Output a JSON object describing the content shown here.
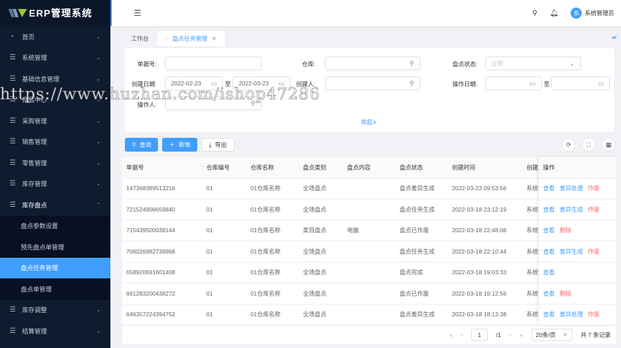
{
  "app": {
    "title": "ERP管理系统"
  },
  "sidebar": {
    "items": [
      {
        "label": "首页",
        "icon": "dashboard-icon"
      },
      {
        "label": "系统管理",
        "icon": "menu-icon"
      },
      {
        "label": "基础信息管理",
        "icon": "menu-icon"
      },
      {
        "label": "商品中心",
        "icon": "menu-icon"
      },
      {
        "label": "采购管理",
        "icon": "menu-icon"
      },
      {
        "label": "销售管理",
        "icon": "menu-icon"
      },
      {
        "label": "零售管理",
        "icon": "menu-icon"
      },
      {
        "label": "库存管理",
        "icon": "menu-icon"
      },
      {
        "label": "库存盘点",
        "icon": "menu-icon",
        "expanded": true
      },
      {
        "label": "库存调整",
        "icon": "menu-icon"
      },
      {
        "label": "结算管理",
        "icon": "menu-icon"
      }
    ],
    "subitems": [
      {
        "label": "盘点参数设置"
      },
      {
        "label": "预先盘点单管理"
      },
      {
        "label": "盘点任务管理",
        "active": true
      },
      {
        "label": "盘点单管理"
      }
    ]
  },
  "header": {
    "user": "系统管理员",
    "avatar_text": "系"
  },
  "tabs": [
    {
      "label": "工作台"
    },
    {
      "label": "盘点任务管理",
      "active": true
    }
  ],
  "search": {
    "doc_no_label": "单据号:",
    "doc_no_value": "",
    "warehouse_label": "仓库:",
    "warehouse_value": "",
    "status_label": "盘点状态:",
    "status_value": "全部",
    "create_date_label": "创建日期:",
    "create_date_from": "2022-02-23",
    "create_date_to": "2022-03-23",
    "to_label": "至",
    "creator_label": "创建人:",
    "creator_value": "",
    "op_date_label": "操作日期:",
    "op_date_from": "",
    "op_date_to": "",
    "operator_label": "操作人:",
    "operator_value": "",
    "collapse_label": "收起∧"
  },
  "toolbar": {
    "query": "查询",
    "add": "新增",
    "export": "导出"
  },
  "table": {
    "columns": [
      "单据号",
      "仓库编号",
      "仓库名称",
      "盘点类别",
      "盘点内容",
      "盘点状态",
      "创建时间",
      "创建人",
      "操作"
    ],
    "rows": [
      {
        "no": "147368389513216",
        "wh_code": "01",
        "wh_name": "01仓库名称",
        "type": "全场盘点",
        "content": "",
        "status": "盘点差异生成",
        "created": "2022-03-23 09:53:56",
        "creator": "系统管理员",
        "ops": [
          {
            "label": "查看",
            "color": "blue"
          },
          {
            "label": "差异处理",
            "color": "blue"
          },
          {
            "label": "作废",
            "color": "red"
          }
        ]
      },
      {
        "no": "721524906659840",
        "wh_code": "01",
        "wh_name": "01仓库名称",
        "type": "全场盘点",
        "content": "",
        "status": "盘点任务生成",
        "created": "2022-03-18 23:12:19",
        "creator": "系统管理员",
        "ops": [
          {
            "label": "查看",
            "color": "blue"
          },
          {
            "label": "差异生成",
            "color": "blue"
          },
          {
            "label": "作废",
            "color": "red"
          }
        ]
      },
      {
        "no": "715439500038144",
        "wh_code": "01",
        "wh_name": "01仓库名称",
        "type": "类目盘点",
        "content": "电脑",
        "status": "盘点已作废",
        "created": "2022-03-18 22:48:08",
        "creator": "系统管理员",
        "ops": [
          {
            "label": "查看",
            "color": "blue"
          },
          {
            "label": "删除",
            "color": "red"
          }
        ]
      },
      {
        "no": "706026982739968",
        "wh_code": "01",
        "wh_name": "01仓库名称",
        "type": "全场盘点",
        "content": "",
        "status": "盘点任务生成",
        "created": "2022-03-18 22:10:44",
        "creator": "系统管理员",
        "ops": [
          {
            "label": "查看",
            "color": "blue"
          },
          {
            "label": "差异生成",
            "color": "blue"
          },
          {
            "label": "作废",
            "color": "red"
          }
        ]
      },
      {
        "no": "658920691601408",
        "wh_code": "01",
        "wh_name": "01仓库名称",
        "type": "全场盘点",
        "content": "",
        "status": "盘点完成",
        "created": "2022-03-18 19:03:33",
        "creator": "系统管理员",
        "ops": [
          {
            "label": "查看",
            "color": "blue"
          }
        ]
      },
      {
        "no": "661283200438272",
        "wh_code": "01",
        "wh_name": "01仓库名称",
        "type": "全场盘点",
        "content": "",
        "status": "盘点已作废",
        "created": "2022-03-18 19:12:56",
        "creator": "系统管理员",
        "ops": [
          {
            "label": "查看",
            "color": "blue"
          },
          {
            "label": "删除",
            "color": "red"
          }
        ]
      },
      {
        "no": "646357224394752",
        "wh_code": "01",
        "wh_name": "01仓库名称",
        "type": "全场盘点",
        "content": "",
        "status": "盘点差异生成",
        "created": "2022-03-18 18:13:38",
        "creator": "系统管理员",
        "ops": [
          {
            "label": "查看",
            "color": "blue"
          },
          {
            "label": "差异处理",
            "color": "blue"
          },
          {
            "label": "作废",
            "color": "red"
          }
        ]
      }
    ]
  },
  "pagination": {
    "current": "1",
    "total_pages": "/1",
    "page_size": "20条/页",
    "total": "共 7 条记录"
  },
  "watermark": "https://www.huzhan.com/ishop47286",
  "colors": {
    "primary": "#409eff",
    "danger": "#f56c6c",
    "sidebar": "#0f1b2e"
  }
}
